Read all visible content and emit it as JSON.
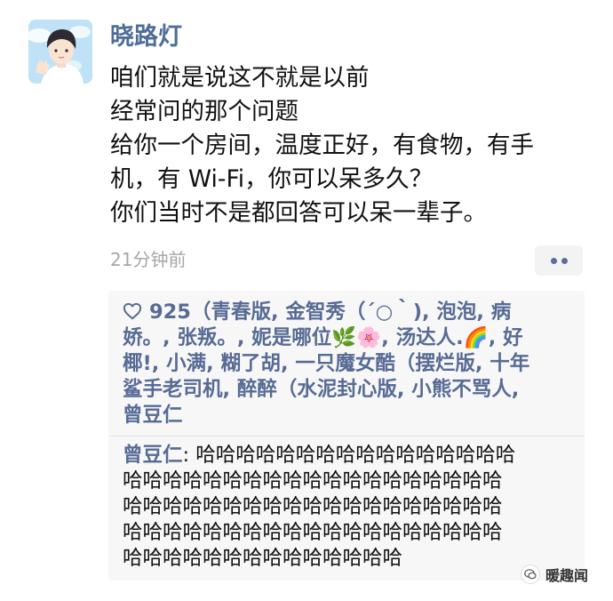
{
  "post": {
    "author": "晓路灯",
    "lines": [
      "咱们就是说这不就是以前",
      "经常问的那个问题",
      "给你一个房间，温度正好，有食物，有手",
      "机，有 Wi-Fi，你可以呆多久？",
      "你们当时不是都回答可以呆一辈子。"
    ],
    "timestamp": "21分钟前"
  },
  "likes": {
    "lines": [
      "925（青春版, 金智秀（´○｀), 泡泡, 病",
      "娇。, 张叛。, 妮是哪位🌿🌸, 汤达人.🌈, 好",
      "椰!, 小满, 糊了胡, 一只魔女酷（摆烂版, 十年",
      "鲨手老司机, 醉醉（水泥封心版, 小熊不骂人,",
      "曾豆仁"
    ]
  },
  "comment": {
    "author": "曾豆仁",
    "separator": ": ",
    "lines": [
      "哈哈哈哈哈哈哈哈哈哈哈哈哈哈哈哈",
      "哈哈哈哈哈哈哈哈哈哈哈哈哈哈哈哈哈哈哈",
      "哈哈哈哈哈哈哈哈哈哈哈哈哈哈哈哈哈哈哈",
      "哈哈哈哈哈哈哈哈哈哈哈哈哈哈哈哈哈哈哈",
      "哈哈哈哈哈哈哈哈哈哈哈哈哈哈"
    ]
  },
  "watermark": {
    "text": "暖趣闻"
  },
  "colors": {
    "link": "#576b95",
    "author": "#4f6d9a",
    "timestamp": "#a7a7a7",
    "panel": "#f7f7f7"
  },
  "icons": {
    "like": "heart-icon",
    "more": "more-dots-icon",
    "watermark": "wechat-logo-icon"
  }
}
